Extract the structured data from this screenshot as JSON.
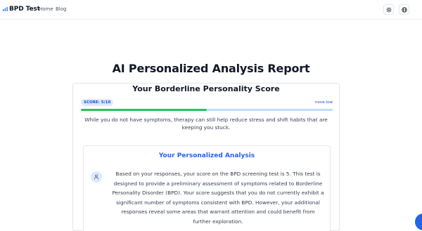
{
  "header": {
    "brand": "BPD Test",
    "nav": {
      "home": "Home",
      "blog": "Blog"
    },
    "icons": {
      "brand": "brain-icon",
      "theme": "sun-icon",
      "language": "globe-icon"
    }
  },
  "report": {
    "title": "AI Personalized Analysis Report",
    "score_card": {
      "title": "Your Borderline Personality Score",
      "badge": "SCORE: 5/10",
      "level": "none-low",
      "progress_fraction": 0.5,
      "description": "While you do not have symptoms, therapy can still help reduce stress and shift habits that are keeping you stuck."
    },
    "analysis": {
      "title": "Your Personalized Analysis",
      "icon": "user-icon",
      "text": "Based on your responses, your score on the BPD screening test is 5. This test is designed to provide a preliminary assessment of symptoms related to Borderline Personality Disorder (BPD). Your score suggests that you do not currently exhibit a significant number of symptoms consistent with BPD. However, your additional responses reveal some areas that warrant attention and could benefit from further exploration."
    }
  },
  "colors": {
    "accent": "#2563eb",
    "progress_fill": "#22c55e",
    "progress_track": "#bfdbfe",
    "badge_bg": "#dbeafe"
  }
}
